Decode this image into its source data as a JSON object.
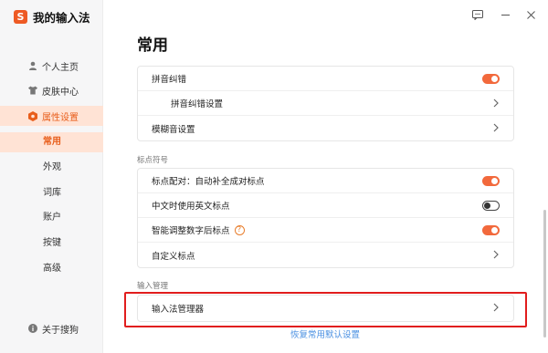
{
  "app": {
    "logo_char": "S",
    "name": "我的输入法"
  },
  "sidebar": {
    "items": [
      {
        "label": "个人主页",
        "icon": "user-icon"
      },
      {
        "label": "皮肤中心",
        "icon": "shirt-icon"
      },
      {
        "label": "属性设置",
        "icon": "hexagon-settings-icon",
        "active": true
      }
    ],
    "subitems": [
      {
        "label": "常用",
        "active": true
      },
      {
        "label": "外观"
      },
      {
        "label": "词库"
      },
      {
        "label": "账户"
      },
      {
        "label": "按键"
      },
      {
        "label": "高级"
      }
    ],
    "about": {
      "label": "关于搜狗",
      "icon": "info-icon"
    }
  },
  "main": {
    "title": "常用",
    "card1": {
      "rows": [
        {
          "label": "拼音纠错",
          "control": "toggle",
          "on": true
        },
        {
          "label": "拼音纠错设置",
          "control": "chevron"
        },
        {
          "label": "模糊音设置",
          "control": "chevron"
        }
      ]
    },
    "punctuation": {
      "section_label": "标点符号",
      "rows": [
        {
          "label": "标点配对：自动补全成对标点",
          "control": "toggle",
          "on": true
        },
        {
          "label": "中文时使用英文标点",
          "control": "toggle",
          "on": false
        },
        {
          "label": "智能调整数字后标点",
          "help": "?",
          "control": "toggle",
          "on": true
        },
        {
          "label": "自定义标点",
          "control": "chevron"
        }
      ]
    },
    "ime_management": {
      "section_label": "输入管理",
      "rows": [
        {
          "label": "输入法管理器",
          "control": "chevron"
        }
      ]
    },
    "restore_link": "恢复常用默认设置"
  },
  "colors": {
    "accent": "#f2693c",
    "highlight": "#e11d1d",
    "link": "#4a90e2"
  }
}
